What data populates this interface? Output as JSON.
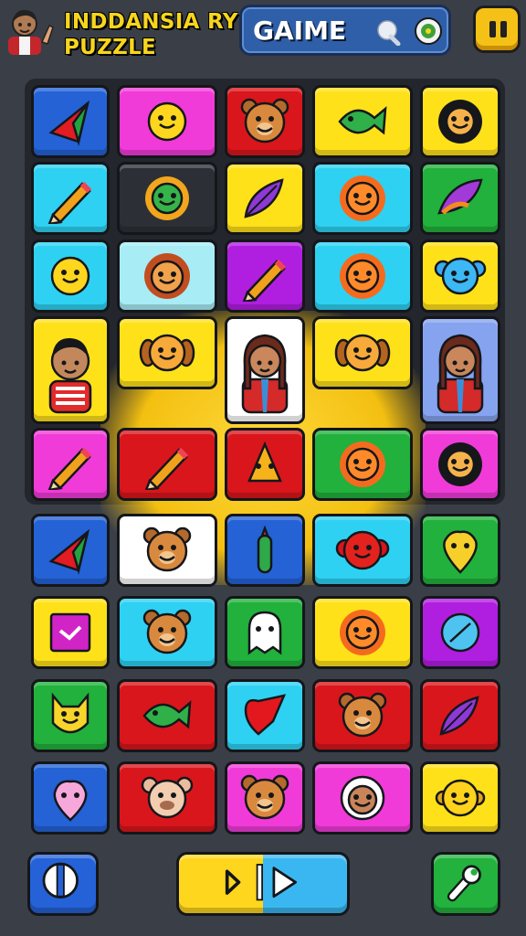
{
  "header": {
    "title_line1": "INDDANSIA RY",
    "title_line2": "PUZZLE",
    "game_label": "GAIME"
  },
  "colors": {
    "blue": "#2462d6",
    "magenta": "#f03bd8",
    "red": "#d9161c",
    "yellow": "#ffe11a",
    "cyan": "#2ed1f2",
    "green": "#21b13c",
    "purple": "#b01ee0",
    "dark": "#2c3036",
    "white": "#ffffff",
    "lightcyan": "#a8ecf5",
    "lavender": "#86a3f0"
  },
  "board": {
    "rows": [
      [
        {
          "bg": "blue",
          "icon": "kite-icon"
        },
        {
          "bg": "magenta",
          "icon": "smiley-icon"
        },
        {
          "bg": "red",
          "icon": "bear-face-icon"
        },
        {
          "bg": "yellow",
          "icon": "fish-icon"
        },
        {
          "bg": "yellow",
          "icon": "sunflower-face-icon"
        }
      ],
      [
        {
          "bg": "cyan",
          "icon": "pencil-icon"
        },
        {
          "bg": "dark",
          "icon": "green-sun-face-icon"
        },
        {
          "bg": "yellow",
          "icon": "feather-icon"
        },
        {
          "bg": "cyan",
          "icon": "sun-face-icon"
        },
        {
          "bg": "green",
          "icon": "leaf-bird-icon"
        }
      ],
      [
        {
          "bg": "cyan",
          "icon": "smiley-icon"
        },
        {
          "bg": "lightcyan",
          "icon": "lion-face-icon"
        },
        {
          "bg": "purple",
          "icon": "pencil-icon"
        },
        {
          "bg": "cyan",
          "icon": "sun-face-icon"
        },
        {
          "bg": "yellow",
          "icon": "blue-blob-face-icon"
        }
      ],
      [
        {
          "bg": "yellow",
          "icon": "boy-icon",
          "big": true
        },
        {
          "bg": "yellow",
          "icon": "puppy-face-icon"
        },
        {
          "bg": "white",
          "icon": "girl-icon",
          "big": true
        },
        {
          "bg": "yellow",
          "icon": "puppy-face-icon"
        },
        {
          "bg": "lavender",
          "icon": "girl-icon",
          "big": true
        }
      ],
      [
        {
          "bg": "magenta",
          "icon": "pencil-icon"
        },
        {
          "bg": "red",
          "icon": "pencil-icon"
        },
        {
          "bg": "red",
          "icon": "star-cone-icon"
        },
        {
          "bg": "green",
          "icon": "sun-face-icon"
        },
        {
          "bg": "magenta",
          "icon": "sunflower-face-icon"
        }
      ],
      [
        {
          "bg": "blue",
          "icon": "kite-icon"
        },
        {
          "bg": "white",
          "icon": "bear-face-icon"
        },
        {
          "bg": "blue",
          "icon": "cactus-icon"
        },
        {
          "bg": "cyan",
          "icon": "monkey-face-icon"
        },
        {
          "bg": "green",
          "icon": "drop-face-icon"
        }
      ],
      [
        {
          "bg": "yellow",
          "icon": "checkbox-icon"
        },
        {
          "bg": "cyan",
          "icon": "bear-face-icon"
        },
        {
          "bg": "green",
          "icon": "ghost-icon"
        },
        {
          "bg": "yellow",
          "icon": "sun-face-icon"
        },
        {
          "bg": "purple",
          "icon": "leaf-icon"
        }
      ],
      [
        {
          "bg": "green",
          "icon": "cat-face-icon"
        },
        {
          "bg": "red",
          "icon": "fish-icon"
        },
        {
          "bg": "cyan",
          "icon": "heart-kite-icon"
        },
        {
          "bg": "red",
          "icon": "bear-face-icon"
        },
        {
          "bg": "red",
          "icon": "feather-icon"
        }
      ],
      [
        {
          "bg": "blue",
          "icon": "pink-drop-icon"
        },
        {
          "bg": "red",
          "icon": "pig-face-icon"
        },
        {
          "bg": "magenta",
          "icon": "bear-face-icon"
        },
        {
          "bg": "magenta",
          "icon": "girl-face-icon"
        },
        {
          "bg": "yellow",
          "icon": "round-face-icon"
        }
      ]
    ]
  },
  "footer": {
    "left_button_icon": "switch-icon",
    "center_button_icon": "play-icon",
    "right_button_icon": "wrench-icon"
  }
}
